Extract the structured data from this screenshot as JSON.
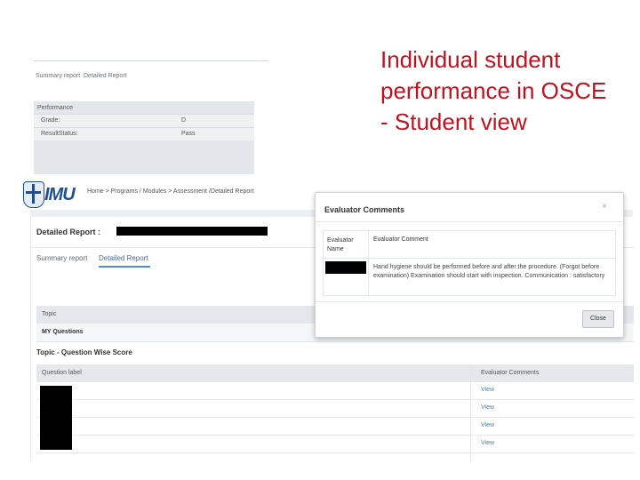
{
  "caption": {
    "lines": [
      "Individual student",
      "performance in OSCE",
      "- Student view"
    ]
  },
  "top_screenshot": {
    "tabs": [
      "Summary report",
      "Detailed Report"
    ],
    "performance_title": "Performance",
    "rows": [
      {
        "label": "Grade:",
        "value": "D"
      },
      {
        "label": "ResultStatus:",
        "value": "Pass"
      }
    ]
  },
  "main_screenshot": {
    "logo_text": "IMU",
    "breadcrumb": "Home > Programs / Modules > Assessment /Detailed Report",
    "detailed_report_title": "Detailed Report :",
    "tabs": [
      "Summary report",
      "Detailed Report"
    ],
    "topic_table": {
      "header": "Topic",
      "rows": [
        "MY Questions"
      ]
    },
    "question_section_title": "Topic - Question Wise Score",
    "question_table": {
      "headers": [
        "Question label",
        "Evaluator Comments"
      ],
      "rows": [
        {
          "action": "View"
        },
        {
          "action": "View"
        },
        {
          "action": "View"
        },
        {
          "action": "View"
        }
      ]
    }
  },
  "modal": {
    "title": "Evaluator Comments",
    "close_glyph": "×",
    "columns": [
      "Evaluator Name",
      "Evaluator Comment"
    ],
    "comment": "Hand hygiene should be performed before and after the procedure. (Forgot before examination) Examination should start with inspection. Communication : satisfactory",
    "close_button": "Close"
  }
}
